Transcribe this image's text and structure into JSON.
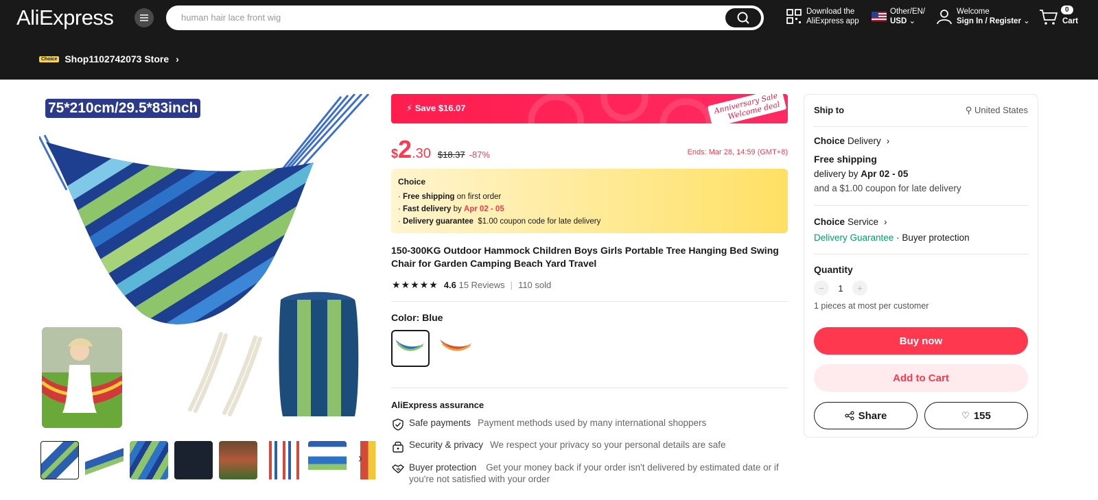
{
  "header": {
    "logo": "AliExpress",
    "search_placeholder": "human hair lace front wig",
    "app_line1": "Download the",
    "app_line2": "AliExpress app",
    "locale_line1": "Other/EN/",
    "locale_line2": "USD",
    "welcome": "Welcome",
    "signin": "Sign In / Register",
    "cart_count": "0",
    "cart_label": "Cart",
    "store_badge": "Choice",
    "store_name": "Shop1102742073 Store"
  },
  "gallery": {
    "size_tag": "75*210cm/29.5*83inch"
  },
  "promo": {
    "save": "Save $16.07",
    "anniversary_line1": "Anniversary Sale",
    "anniversary_line2": "Welcome deal"
  },
  "price": {
    "currency": "$",
    "integer": "2",
    "decimal": ".30",
    "original": "$18.37",
    "discount": "-87%",
    "ends": "Ends: Mar 28, 14:59 (GMT+8)"
  },
  "choice_box": {
    "title": "Choice",
    "free_shipping": "Free shipping",
    "free_shipping_tail": "on first order",
    "fast_delivery": "Fast delivery",
    "fast_delivery_mid": "by",
    "fast_delivery_date": "Apr 02 - 05",
    "guarantee": "Delivery guarantee",
    "guarantee_tail": "$1.00 coupon code for late delivery"
  },
  "product": {
    "title": "150-300KG Outdoor Hammock Children Boys Girls Portable Tree Hanging Bed Swing Chair for Garden Camping Beach Yard Travel",
    "rating": "4.6",
    "reviews": "15 Reviews",
    "sold": "110 sold",
    "color_label": "Color: Blue"
  },
  "assurance": {
    "title": "AliExpress assurance",
    "items": [
      {
        "label": "Safe payments",
        "desc": "Payment methods used by many international shoppers"
      },
      {
        "label": "Security & privacy",
        "desc": "We respect your privacy so your personal details are safe"
      },
      {
        "label": "Buyer protection",
        "desc": "Get your money back if your order isn't delivered by estimated date or if you're not satisfied with your order"
      }
    ]
  },
  "panel": {
    "ship_to": "Ship to",
    "country": "United States",
    "choice_delivery_b": "Choice",
    "choice_delivery": "Delivery",
    "free_shipping": "Free shipping",
    "delivery_by": "delivery by",
    "delivery_date": "Apr 02 - 05",
    "coupon_note": "and a $1.00 coupon for late delivery",
    "choice_service_b": "Choice",
    "choice_service": "Service",
    "delivery_guarantee": "Delivery Guarantee",
    "buyer_protection": "Buyer protection",
    "quantity_label": "Quantity",
    "quantity_value": "1",
    "quantity_note": "1 pieces at most per customer",
    "buy_now": "Buy now",
    "add_to_cart": "Add to Cart",
    "share": "Share",
    "wishlist_count": "155"
  },
  "colors": {
    "accent": "#fd384f",
    "header_bg": "#191919",
    "guarantee_green": "#00a166"
  }
}
